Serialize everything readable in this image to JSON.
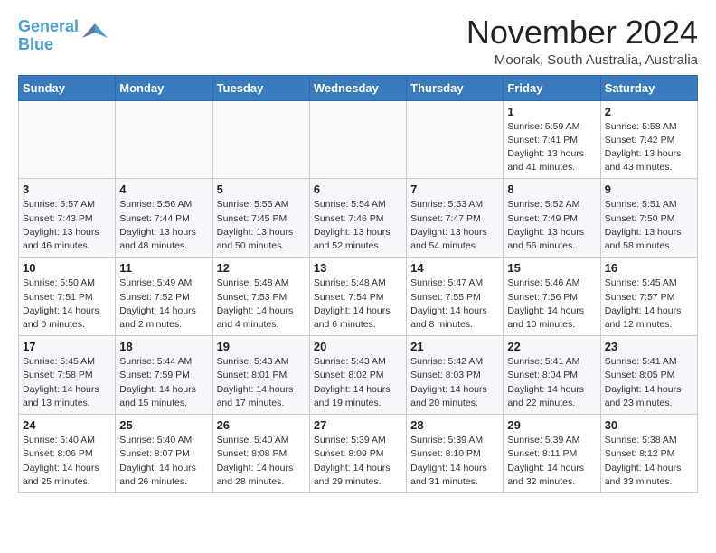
{
  "header": {
    "logo_general": "General",
    "logo_blue": "Blue",
    "month_title": "November 2024",
    "location": "Moorak, South Australia, Australia"
  },
  "weekdays": [
    "Sunday",
    "Monday",
    "Tuesday",
    "Wednesday",
    "Thursday",
    "Friday",
    "Saturday"
  ],
  "weeks": [
    [
      {
        "day": "",
        "info": ""
      },
      {
        "day": "",
        "info": ""
      },
      {
        "day": "",
        "info": ""
      },
      {
        "day": "",
        "info": ""
      },
      {
        "day": "",
        "info": ""
      },
      {
        "day": "1",
        "info": "Sunrise: 5:59 AM\nSunset: 7:41 PM\nDaylight: 13 hours\nand 41 minutes."
      },
      {
        "day": "2",
        "info": "Sunrise: 5:58 AM\nSunset: 7:42 PM\nDaylight: 13 hours\nand 43 minutes."
      }
    ],
    [
      {
        "day": "3",
        "info": "Sunrise: 5:57 AM\nSunset: 7:43 PM\nDaylight: 13 hours\nand 46 minutes."
      },
      {
        "day": "4",
        "info": "Sunrise: 5:56 AM\nSunset: 7:44 PM\nDaylight: 13 hours\nand 48 minutes."
      },
      {
        "day": "5",
        "info": "Sunrise: 5:55 AM\nSunset: 7:45 PM\nDaylight: 13 hours\nand 50 minutes."
      },
      {
        "day": "6",
        "info": "Sunrise: 5:54 AM\nSunset: 7:46 PM\nDaylight: 13 hours\nand 52 minutes."
      },
      {
        "day": "7",
        "info": "Sunrise: 5:53 AM\nSunset: 7:47 PM\nDaylight: 13 hours\nand 54 minutes."
      },
      {
        "day": "8",
        "info": "Sunrise: 5:52 AM\nSunset: 7:49 PM\nDaylight: 13 hours\nand 56 minutes."
      },
      {
        "day": "9",
        "info": "Sunrise: 5:51 AM\nSunset: 7:50 PM\nDaylight: 13 hours\nand 58 minutes."
      }
    ],
    [
      {
        "day": "10",
        "info": "Sunrise: 5:50 AM\nSunset: 7:51 PM\nDaylight: 14 hours\nand 0 minutes."
      },
      {
        "day": "11",
        "info": "Sunrise: 5:49 AM\nSunset: 7:52 PM\nDaylight: 14 hours\nand 2 minutes."
      },
      {
        "day": "12",
        "info": "Sunrise: 5:48 AM\nSunset: 7:53 PM\nDaylight: 14 hours\nand 4 minutes."
      },
      {
        "day": "13",
        "info": "Sunrise: 5:48 AM\nSunset: 7:54 PM\nDaylight: 14 hours\nand 6 minutes."
      },
      {
        "day": "14",
        "info": "Sunrise: 5:47 AM\nSunset: 7:55 PM\nDaylight: 14 hours\nand 8 minutes."
      },
      {
        "day": "15",
        "info": "Sunrise: 5:46 AM\nSunset: 7:56 PM\nDaylight: 14 hours\nand 10 minutes."
      },
      {
        "day": "16",
        "info": "Sunrise: 5:45 AM\nSunset: 7:57 PM\nDaylight: 14 hours\nand 12 minutes."
      }
    ],
    [
      {
        "day": "17",
        "info": "Sunrise: 5:45 AM\nSunset: 7:58 PM\nDaylight: 14 hours\nand 13 minutes."
      },
      {
        "day": "18",
        "info": "Sunrise: 5:44 AM\nSunset: 7:59 PM\nDaylight: 14 hours\nand 15 minutes."
      },
      {
        "day": "19",
        "info": "Sunrise: 5:43 AM\nSunset: 8:01 PM\nDaylight: 14 hours\nand 17 minutes."
      },
      {
        "day": "20",
        "info": "Sunrise: 5:43 AM\nSunset: 8:02 PM\nDaylight: 14 hours\nand 19 minutes."
      },
      {
        "day": "21",
        "info": "Sunrise: 5:42 AM\nSunset: 8:03 PM\nDaylight: 14 hours\nand 20 minutes."
      },
      {
        "day": "22",
        "info": "Sunrise: 5:41 AM\nSunset: 8:04 PM\nDaylight: 14 hours\nand 22 minutes."
      },
      {
        "day": "23",
        "info": "Sunrise: 5:41 AM\nSunset: 8:05 PM\nDaylight: 14 hours\nand 23 minutes."
      }
    ],
    [
      {
        "day": "24",
        "info": "Sunrise: 5:40 AM\nSunset: 8:06 PM\nDaylight: 14 hours\nand 25 minutes."
      },
      {
        "day": "25",
        "info": "Sunrise: 5:40 AM\nSunset: 8:07 PM\nDaylight: 14 hours\nand 26 minutes."
      },
      {
        "day": "26",
        "info": "Sunrise: 5:40 AM\nSunset: 8:08 PM\nDaylight: 14 hours\nand 28 minutes."
      },
      {
        "day": "27",
        "info": "Sunrise: 5:39 AM\nSunset: 8:09 PM\nDaylight: 14 hours\nand 29 minutes."
      },
      {
        "day": "28",
        "info": "Sunrise: 5:39 AM\nSunset: 8:10 PM\nDaylight: 14 hours\nand 31 minutes."
      },
      {
        "day": "29",
        "info": "Sunrise: 5:39 AM\nSunset: 8:11 PM\nDaylight: 14 hours\nand 32 minutes."
      },
      {
        "day": "30",
        "info": "Sunrise: 5:38 AM\nSunset: 8:12 PM\nDaylight: 14 hours\nand 33 minutes."
      }
    ]
  ]
}
